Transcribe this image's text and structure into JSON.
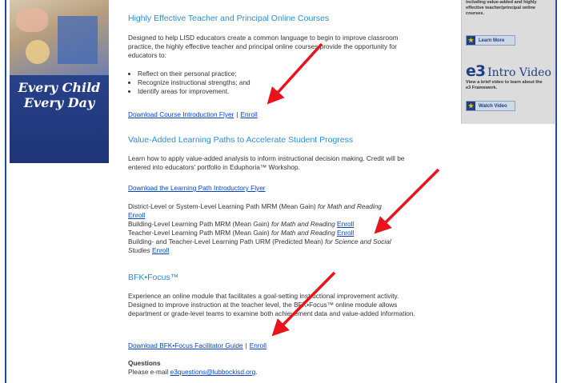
{
  "banner": {
    "line1": "Every Child",
    "line2": "Every Day"
  },
  "courses": {
    "title": "Highly Effective Teacher and Principal Online Courses",
    "intro": "Designed to help LISD educators create a common language to begin to improve classroom practice, the highly effective teacher and principal online courses provide the opportunity for educators to:",
    "bullets": [
      "Reflect on their personal practice;",
      "Recognize instructional strengths; and",
      "Identify areas for improvement."
    ],
    "download_link": "Download Course Introduction Flyer",
    "separator": "|",
    "enroll_link": "Enroll"
  },
  "value_added": {
    "title": "Value-Added Learning Paths to Accelerate Student Progress",
    "intro": "Learn how to apply value-added analysis to inform instructional decision making. Credit will be entered into educators' portfolio in Eduphoria™ Workshop.",
    "download_link": "Download the Learning Path Introductory Flyer",
    "paths": [
      {
        "text": "District-Level or System-Level Learning Path MRM (Mean Gain) ",
        "italic": "for Math and Reading",
        "enroll": "Enroll"
      },
      {
        "text": "Building-Level Learning Path MRM (Mean Gain) ",
        "italic": "for Math and Reading",
        "enroll": "Enroll"
      },
      {
        "text": "Teacher-Level Learning Path MRM (Mean Gain) ",
        "italic": "for Math and Reading",
        "enroll": "Enroll"
      },
      {
        "text": "Building- and Teacher-Level Learning Path URM (Predicted Mean) ",
        "italic": "for Science and Social",
        "italic2": "Studies",
        "enroll": "Enroll"
      }
    ]
  },
  "bfk": {
    "title": "BFK•Focus™",
    "intro": "Experience an online module that facilitates a goal-setting instructional improvement activity. Designed to improve instruction at the teacher level, the BFK•Focus™ online module allows department or grade-level teams to examine both achievement data and value-added information.",
    "download_link": "Download BFK•Focus Facilitator Guide",
    "separator": "|",
    "enroll_link": "Enroll"
  },
  "questions": {
    "title": "Questions",
    "prefix": "Please e-mail ",
    "email": "e3questions@lubbockisd.org",
    "suffix": "."
  },
  "sidebar": {
    "blurb_top": "including value-added and highly effective teacher/principal online courses.",
    "learn_more": "Learn More",
    "logo": "e3",
    "intro_video": "Intro Video",
    "video_blurb": "View a brief video to learn about the e3 Framework.",
    "watch_video": "Watch Video"
  },
  "colors": {
    "heading": "#2d8ed1",
    "link": "#0645c8",
    "frame": "#1f4e96",
    "arrow": "#e8131b"
  }
}
